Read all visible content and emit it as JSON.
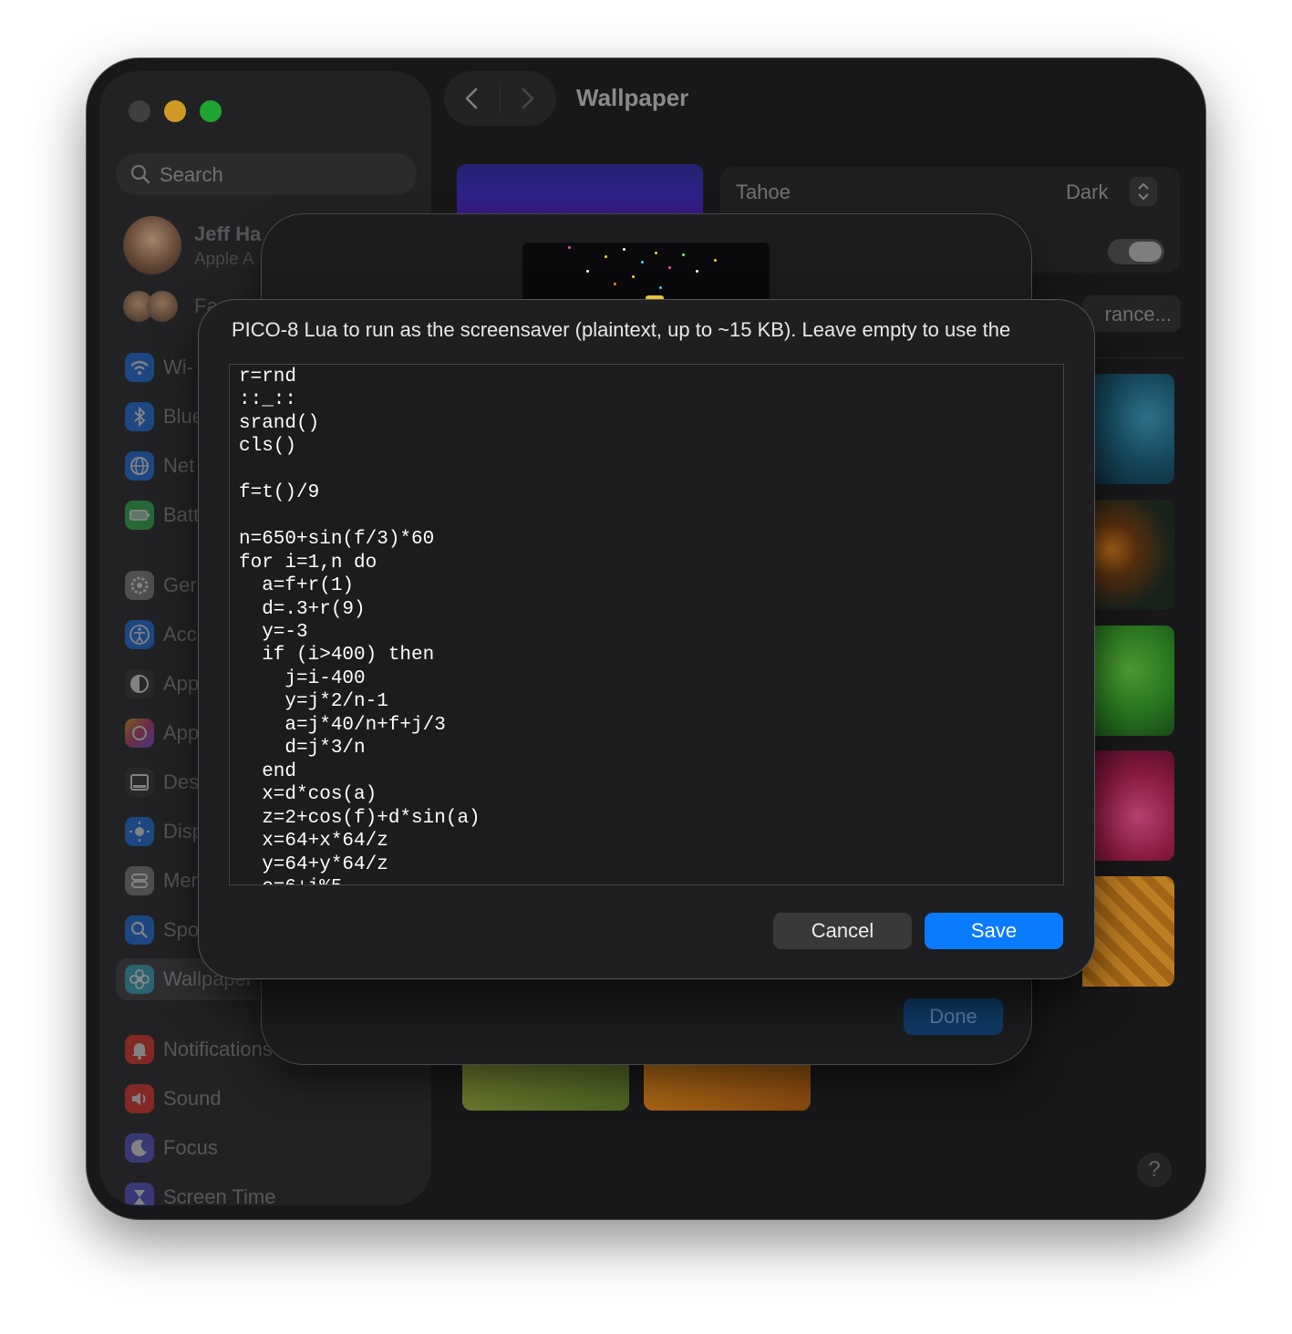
{
  "window": {
    "title": "Wallpaper"
  },
  "sidebar": {
    "search_placeholder": "Search",
    "profile": {
      "name": "Jeff Ha",
      "subtitle": "Apple A"
    },
    "family_label": "Fa",
    "items": [
      {
        "label": "Wi-",
        "icon": "wifi-icon",
        "color": "#1f7dff"
      },
      {
        "label": "Blue",
        "icon": "bluetooth-icon",
        "color": "#1f7dff"
      },
      {
        "label": "Net",
        "icon": "network-icon",
        "color": "#1f7dff"
      },
      {
        "label": "Batt",
        "icon": "battery-icon",
        "color": "#34c759"
      },
      {
        "label": "Ger",
        "icon": "gear-icon",
        "color": "#8e8e93"
      },
      {
        "label": "Acc",
        "icon": "accessibility-icon",
        "color": "#1f7dff"
      },
      {
        "label": "App",
        "icon": "appearance-icon",
        "color": "#3a3a3c"
      },
      {
        "label": "App",
        "icon": "apple-intelligence-icon",
        "color": "#d0407a"
      },
      {
        "label": "Des",
        "icon": "desktop-dock-icon",
        "color": "#3a3a3c"
      },
      {
        "label": "Disp",
        "icon": "display-icon",
        "color": "#1f7dff"
      },
      {
        "label": "Mer",
        "icon": "menu-bar-icon",
        "color": "#8e8e93"
      },
      {
        "label": "Spo",
        "icon": "spotlight-icon",
        "color": "#1f7dff"
      },
      {
        "label": "Wallpaper",
        "icon": "wallpaper-icon",
        "color": "#30b0c7"
      },
      {
        "label": "Notifications",
        "icon": "notifications-icon",
        "color": "#ff3b30"
      },
      {
        "label": "Sound",
        "icon": "sound-icon",
        "color": "#ff3b30"
      },
      {
        "label": "Focus",
        "icon": "focus-icon",
        "color": "#5e5ce6"
      },
      {
        "label": "Screen Time",
        "icon": "screen-time-icon",
        "color": "#5e5ce6"
      }
    ]
  },
  "main": {
    "wallpaper_name": "Tahoe",
    "mode_value": "Dark",
    "appearance_button": "rance..."
  },
  "background_sheet": {
    "done_label": "Done"
  },
  "dialog": {
    "prompt": "PICO-8 Lua to run as the screensaver (plaintext, up to ~15 KB). Leave empty to use the",
    "code": "r=rnd\n::_::\nsrand()\ncls()\n\nf=t()/9\n\nn=650+sin(f/3)*60\nfor i=1,n do\n  a=f+r(1)\n  d=.3+r(9)\n  y=-3\n  if (i>400) then\n    j=i-400\n    y=j*2/n-1\n    a=j*40/n+f+j/3\n    d=j*3/n\n  end\n  x=d*cos(a)\n  z=2+cos(f)+d*sin(a)\n  x=64+x*64/z\n  y=64+y*64/z\n  c=6+i%5",
    "cancel_label": "Cancel",
    "save_label": "Save",
    "accent_color": "#0a7bff"
  }
}
